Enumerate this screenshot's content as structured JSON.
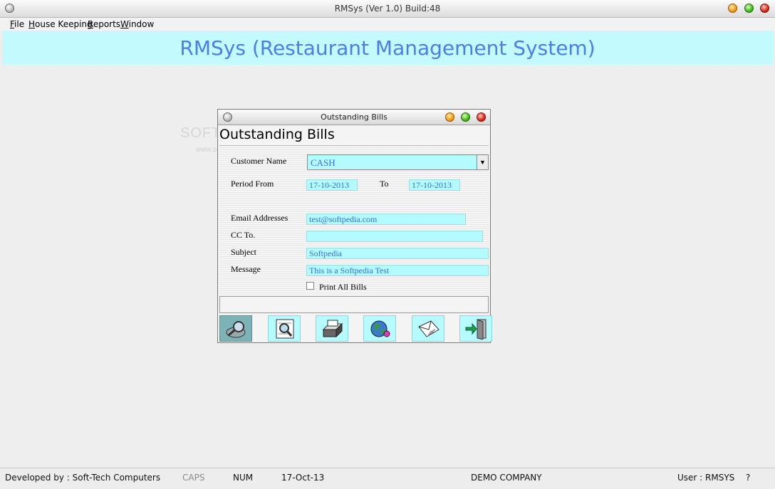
{
  "window": {
    "title": "RMSys (Ver 1.0) Build:48"
  },
  "menu": [
    "File",
    "House Keeping",
    "Reports",
    "Window"
  ],
  "banner": {
    "text": "RMSys (Restaurant Management System)"
  },
  "watermark": {
    "line1": "SOFTPEDIA",
    "line2": "www.softpedia.com"
  },
  "dialog": {
    "title": "Outstanding Bills",
    "heading": "Outstanding Bills",
    "customer_name_label": "Customer Name",
    "customer_name_value": "CASH",
    "period_from_label": "Period From",
    "period_from_value": "17-10-2013",
    "to_label": "To",
    "to_value": "17-10-2013",
    "email_label": "Email Addresses",
    "email_value": "test@softpedia.com",
    "cc_label": "CC To.",
    "cc_value": "",
    "subject_label": "Subject",
    "subject_value": "Softpedia",
    "message_label": "Message",
    "message_value": "This is a Softpedia Test",
    "print_all_label": "Print All Bills",
    "buttons": [
      "search-icon",
      "preview-icon",
      "printer-icon",
      "globe-icon",
      "email-icon",
      "exit-icon"
    ]
  },
  "status": {
    "developer": "Developed by : Soft-Tech Computers",
    "caps": "CAPS",
    "num": "NUM",
    "date": "17-Oct-13",
    "company": "DEMO COMPANY",
    "user": "User : RMSYS",
    "help": "?"
  }
}
